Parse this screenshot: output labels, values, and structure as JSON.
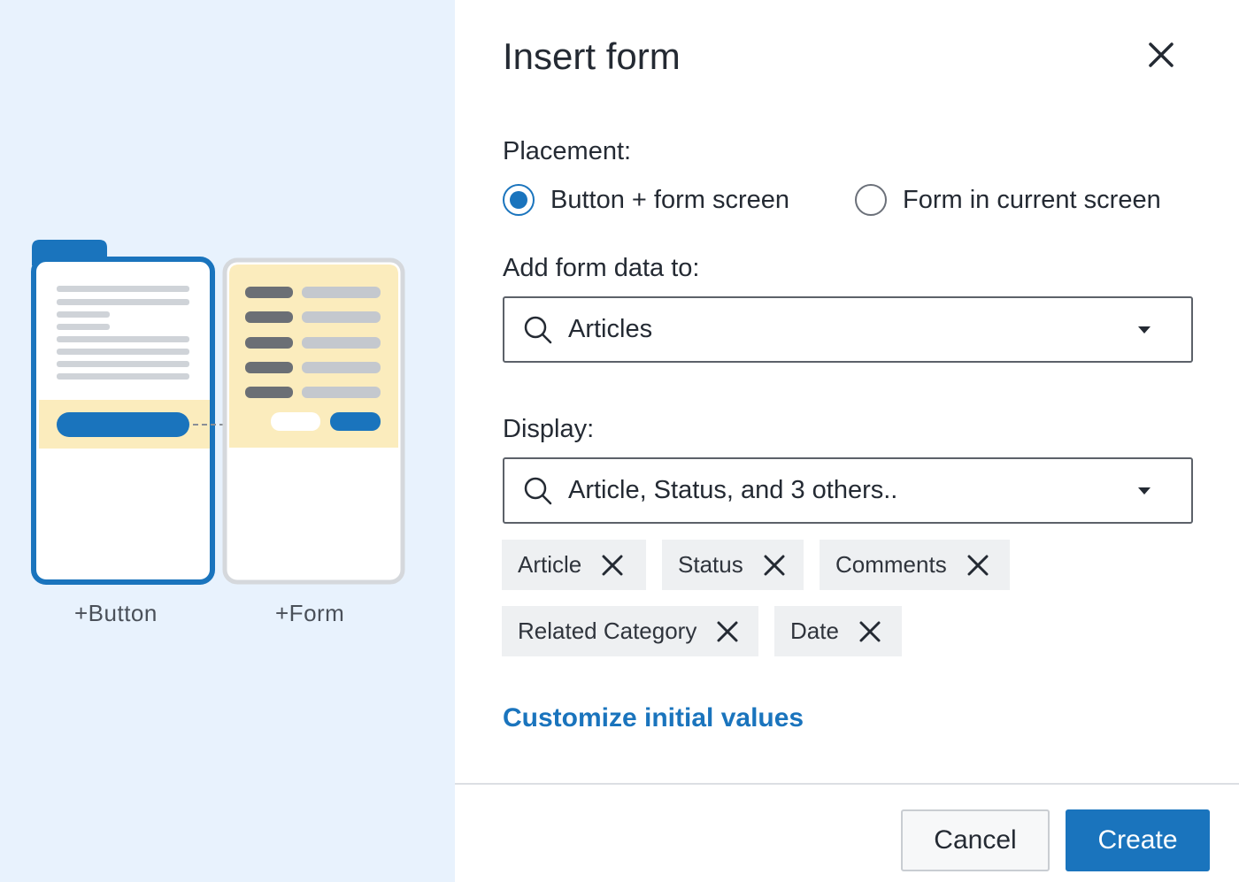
{
  "illustration": {
    "button_label": "+Button",
    "form_label": "+Form"
  },
  "dialog": {
    "title": "Insert form",
    "placement": {
      "label": "Placement:",
      "options": [
        {
          "label": "Button + form screen",
          "selected": true
        },
        {
          "label": "Form in current screen",
          "selected": false
        }
      ]
    },
    "data_source": {
      "label": "Add form data to:",
      "value": "Articles"
    },
    "display": {
      "label": "Display:",
      "value": "Article, Status, and 3 others..",
      "chips": [
        "Article",
        "Status",
        "Comments",
        "Related Category",
        "Date"
      ]
    },
    "customize_link": "Customize initial values",
    "cancel_label": "Cancel",
    "create_label": "Create"
  },
  "colors": {
    "accent": "#1a74bd",
    "left_panel_bg": "#e8f2fd",
    "highlight_yellow": "#fbecbd"
  }
}
